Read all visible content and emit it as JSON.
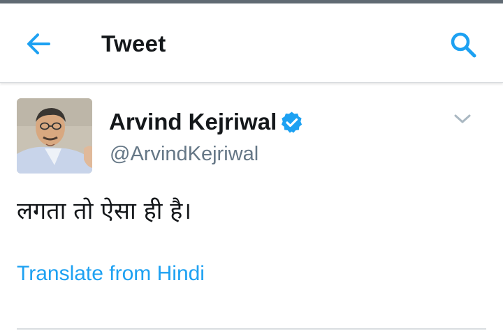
{
  "app_bar": {
    "title": "Tweet",
    "back_icon": "arrow-left-icon",
    "search_icon": "search-icon"
  },
  "tweet": {
    "author": {
      "name": "Arvind Kejriwal",
      "handle": "@ArvindKejriwal",
      "verified": true
    },
    "text": "लगता तो ऐसा ही है।",
    "translate_label": "Translate from Hindi",
    "more_icon": "chevron-down-icon"
  },
  "colors": {
    "accent": "#1da1f2",
    "text_primary": "#14171a",
    "text_secondary": "#657786",
    "verified": "#1da1f2"
  }
}
